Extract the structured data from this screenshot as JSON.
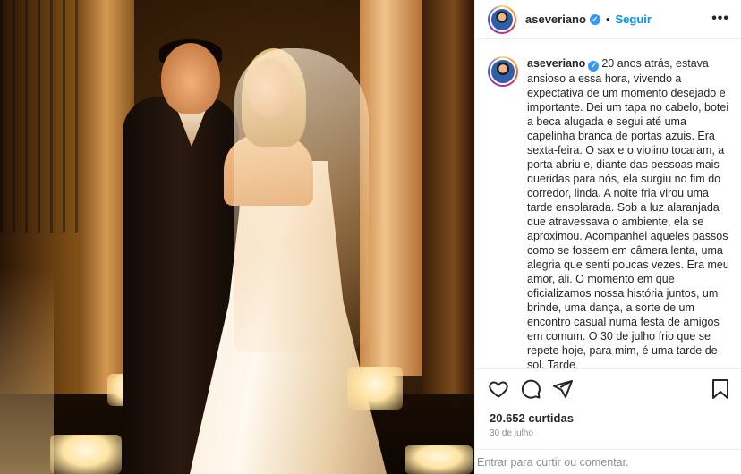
{
  "post": {
    "username": "aseveriano",
    "follow_label": "Seguir",
    "separator": "•",
    "more_label": "•••",
    "caption": "20 anos atrás, estava ansioso a essa hora, vivendo a expectativa de um momento desejado e importante. Dei um tapa no cabelo, botei a beca alugada e segui até uma capelinha branca de portas azuis. Era sexta-feira. O sax e o violino tocaram, a porta abriu e, diante das pessoas mais queridas para nós, ela surgiu no fim do corredor, linda. A noite fria virou uma tarde ensolarada. Sob a luz alaranjada que atravessava o ambiente, ela se aproximou. Acompanhei aqueles passos como se fossem em câmera lenta, uma alegria que senti poucas vezes. Era meu amor, ali. O momento em que oficializamos nossa história juntos, um brinde, uma dança, a sorte de um encontro casual numa festa de amigos em comum. O 30 de julho frio que se repete hoje, para mim, é uma tarde de sol. Tarde",
    "likes": "20.652 curtidas",
    "date": "30 de julho",
    "comment_placeholder": "Entrar para curtir ou comentar.",
    "verified_mark": "✓"
  },
  "icons": {
    "like": "heart-icon",
    "comment": "comment-icon",
    "share": "send-icon",
    "save": "bookmark-icon",
    "verified": "verified-badge-icon"
  },
  "colors": {
    "link": "#0095f6",
    "verified": "#3897f0",
    "text": "#262626",
    "muted": "#8e8e8e"
  }
}
